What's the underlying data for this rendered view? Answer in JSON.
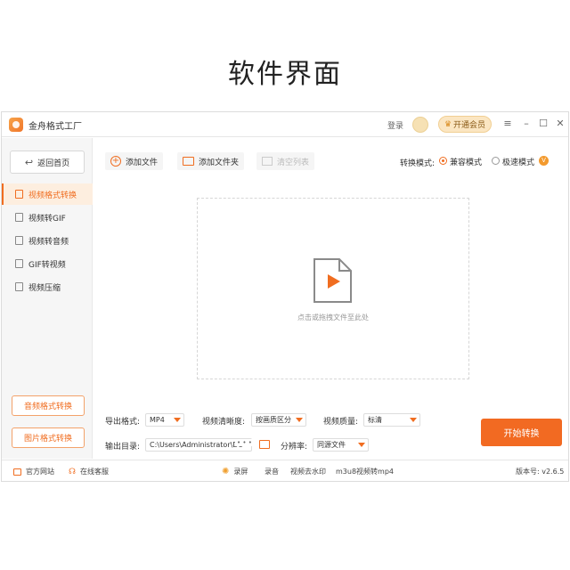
{
  "page_title": "软件界面",
  "titlebar": {
    "app_name": "金舟格式工厂",
    "login": "登录",
    "vip_button": "开通会员",
    "menu_icon": "≡",
    "min_icon": "–",
    "max_icon": "☐",
    "close_icon": "✕"
  },
  "sidebar": {
    "home_button": "返回首页",
    "items": [
      {
        "label": "视频格式转换"
      },
      {
        "label": "视频转GIF"
      },
      {
        "label": "视频转音频"
      },
      {
        "label": "GIF转视频"
      },
      {
        "label": "视频压缩"
      }
    ],
    "audio_button": "音频格式转换",
    "image_button": "图片格式转换"
  },
  "toolbar": {
    "add_file": "添加文件",
    "add_folder": "添加文件夹",
    "clear_list": "清空列表",
    "mode_label": "转换模式:",
    "mode_compat": "兼容模式",
    "mode_fast": "极速模式",
    "vip_badge": "V"
  },
  "drop_area": {
    "hint": "点击或拖拽文件至此处"
  },
  "settings": {
    "format_label": "导出格式:",
    "format_value": "MP4",
    "clarity_label": "视频清晰度:",
    "clarity_value": "按画质区分",
    "quality_label": "视频质量:",
    "quality_value": "标清",
    "output_label": "输出目录:",
    "output_value": "C:\\Users\\Administrator\\De",
    "output_more": "• • •",
    "resolution_label": "分辨率:",
    "resolution_value": "同源文件",
    "start_button": "开始转换"
  },
  "statusbar": {
    "website": "官方网站",
    "support": "在线客服",
    "record": "录屏",
    "audio_record": "录音",
    "watermark": "视频去水印",
    "m3u8": "m3u8视频转mp4",
    "version": "版本号: v2.6.5"
  },
  "colors": {
    "accent": "#f06d20",
    "start_button": "#f26a22",
    "vip_bg": "#fbe6c2"
  }
}
